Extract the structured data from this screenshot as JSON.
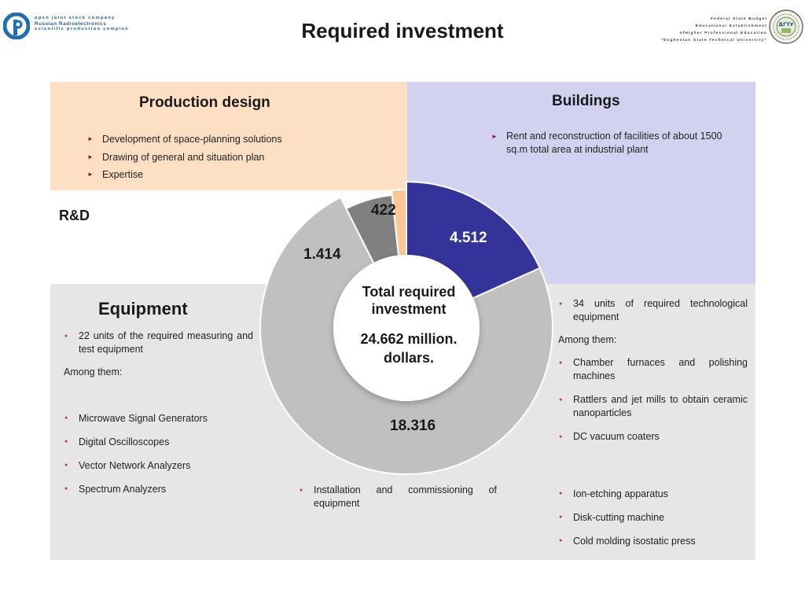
{
  "header": {
    "title": "Required investment",
    "left_logo": {
      "line1": "open joint stock company",
      "line2": "Russian Radioelectronics",
      "line3": "scientific production complex"
    },
    "right_logo": {
      "lines": [
        "Federal State Budget",
        "Educational Establishment",
        "ofHigher Professional Education",
        "\"Daghestan State Technical University\""
      ],
      "seal_text": "ДГТУ"
    }
  },
  "production_design": {
    "title": "Production design",
    "items": [
      "Development of space-planning solutions",
      "Drawing of general and situation plan",
      "Expertise"
    ]
  },
  "buildings": {
    "title": "Buildings",
    "items": [
      "Rent and reconstruction of facilities of about 1500 sq.m total area at industrial plant"
    ]
  },
  "rnd": {
    "title": "R&D"
  },
  "equipment": {
    "title": "Equipment",
    "left_intro": "22 units of the required measuring and test equipment",
    "left_among": "Among them:",
    "left_items": [
      "Microwave Signal Generators",
      "Digital Oscilloscopes",
      "Vector Network Analyzers",
      "Spectrum Analyzers"
    ],
    "middle_item": "Installation and commissioning of equipment",
    "right_intro": "34 units of required technological equipment",
    "right_among": "Among them:",
    "right_items_a": [
      "Chamber furnaces and polishing machines",
      "Rattlers and jet mills to obtain ceramic nanoparticles",
      "DC vacuum coaters"
    ],
    "right_items_b": [
      "Ion-etching apparatus",
      "Disk-cutting machine",
      "Cold molding isostatic press"
    ]
  },
  "chart_data": {
    "type": "pie",
    "donut": true,
    "center_label": "Total required investment",
    "center_value": "24.662 million. dollars.",
    "total": 24.662,
    "slices": [
      {
        "label": "4.512",
        "value": 4.512,
        "color": "#33339a",
        "category": "Buildings"
      },
      {
        "label": "18.316",
        "value": 18.316,
        "color": "#c0c0c0",
        "category": "Equipment"
      },
      {
        "label": "1.414",
        "value": 1.414,
        "color": "#808080",
        "category": "R&D"
      },
      {
        "label": "422",
        "value": 0.422,
        "color": "#fcc793",
        "category": "Production design"
      }
    ],
    "legend": "none"
  }
}
